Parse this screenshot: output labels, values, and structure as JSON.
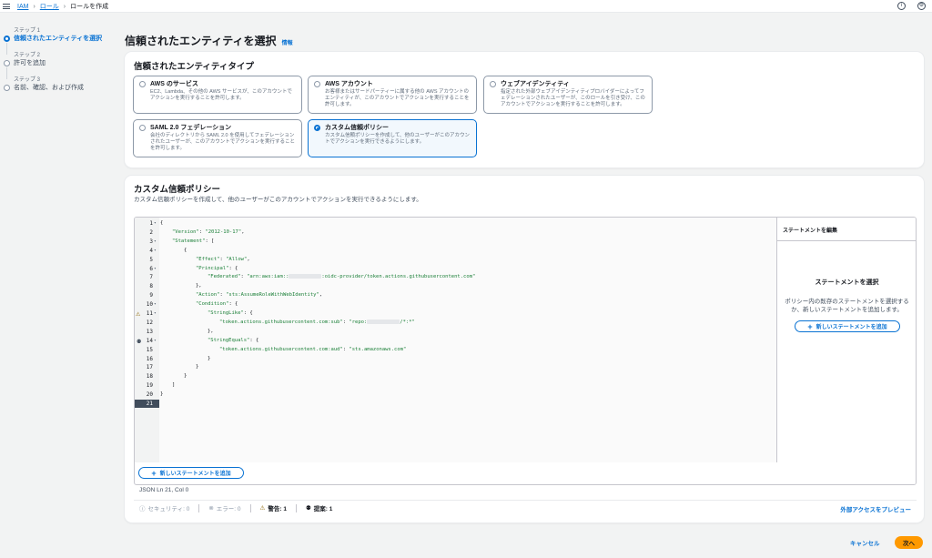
{
  "breadcrumb": {
    "items": [
      "IAM",
      "ロール",
      "ロールを作成"
    ]
  },
  "steps": [
    {
      "num": "ステップ 1",
      "title": "信頼されたエンティティを選択",
      "active": true
    },
    {
      "num": "ステップ 2",
      "title": "許可を追加",
      "active": false
    },
    {
      "num": "ステップ 3",
      "title": "名前、確認、および作成",
      "active": false
    }
  ],
  "page": {
    "title": "信頼されたエンティティを選択",
    "info": "情報"
  },
  "entity_type": {
    "heading": "信頼されたエンティティタイプ",
    "options": [
      {
        "title": "AWS のサービス",
        "desc": "EC2、Lambda、その他の AWS サービスが、このアカウントでアクションを実行することを許可します。",
        "selected": false
      },
      {
        "title": "AWS アカウント",
        "desc": "お客様またはサードパーティーに属する他の AWS アカウントのエンティティが、このアカウントでアクションを実行することを許可します。",
        "selected": false
      },
      {
        "title": "ウェブアイデンティティ",
        "desc": "指定された外部ウェブアイデンティティプロバイダーによってフェデレーションされたユーザーが、このロールを引き受け、このアカウントでアクションを実行することを許可します。",
        "selected": false
      },
      {
        "title": "SAML 2.0 フェデレーション",
        "desc": "会社のディレクトリから SAML 2.0 を使用してフェデレーションされたユーザーが、このアカウントでアクションを実行することを許可します。",
        "selected": false
      },
      {
        "title": "カスタム信頼ポリシー",
        "desc": "カスタム信頼ポリシーを作成して、他のユーザーがこのアカウントでアクションを実行できるようにします。",
        "selected": true
      }
    ]
  },
  "custom_policy": {
    "title": "カスタム信頼ポリシー",
    "desc": "カスタム信頼ポリシーを作成して、他のユーザーがこのアカウントでアクションを実行できるようにします。",
    "code_lines": [
      {
        "n": "1",
        "fold": true,
        "indent": 0,
        "parts": [
          [
            "t",
            "{"
          ]
        ]
      },
      {
        "n": "2",
        "fold": false,
        "indent": 1,
        "parts": [
          [
            "s",
            "\"Version\""
          ],
          [
            "t",
            ": "
          ],
          [
            "s",
            "\"2012-10-17\""
          ],
          [
            "t",
            ","
          ]
        ]
      },
      {
        "n": "3",
        "fold": true,
        "indent": 1,
        "parts": [
          [
            "s",
            "\"Statement\""
          ],
          [
            "t",
            ": ["
          ]
        ]
      },
      {
        "n": "4",
        "fold": true,
        "indent": 2,
        "parts": [
          [
            "t",
            "{"
          ]
        ]
      },
      {
        "n": "5",
        "fold": false,
        "indent": 3,
        "parts": [
          [
            "s",
            "\"Effect\""
          ],
          [
            "t",
            ": "
          ],
          [
            "s",
            "\"Allow\""
          ],
          [
            "t",
            ","
          ]
        ]
      },
      {
        "n": "6",
        "fold": true,
        "indent": 3,
        "parts": [
          [
            "s",
            "\"Principal\""
          ],
          [
            "t",
            ": {"
          ]
        ]
      },
      {
        "n": "7",
        "fold": false,
        "indent": 4,
        "parts": [
          [
            "s",
            "\"Federated\""
          ],
          [
            "t",
            ": "
          ],
          [
            "s",
            "\"arn:aws:iam::"
          ],
          [
            "r",
            ""
          ],
          [
            "s",
            ":oidc-provider/token.actions.githubusercontent.com\""
          ]
        ]
      },
      {
        "n": "8",
        "fold": false,
        "indent": 3,
        "parts": [
          [
            "t",
            "},"
          ]
        ]
      },
      {
        "n": "9",
        "fold": false,
        "indent": 3,
        "parts": [
          [
            "s",
            "\"Action\""
          ],
          [
            "t",
            ": "
          ],
          [
            "s",
            "\"sts:AssumeRoleWithWebIdentity\""
          ],
          [
            "t",
            ","
          ]
        ]
      },
      {
        "n": "10",
        "fold": true,
        "indent": 3,
        "parts": [
          [
            "s",
            "\"Condition\""
          ],
          [
            "t",
            ": {"
          ]
        ]
      },
      {
        "n": "11",
        "fold": true,
        "indent": 4,
        "parts": [
          [
            "s",
            "\"StringLike\""
          ],
          [
            "t",
            ": {"
          ]
        ]
      },
      {
        "n": "12",
        "fold": false,
        "indent": 5,
        "parts": [
          [
            "s",
            "\"token.actions.githubusercontent.com:sub\""
          ],
          [
            "t",
            ": "
          ],
          [
            "s",
            "\"repo:"
          ],
          [
            "r",
            ""
          ],
          [
            "s",
            "/*:*\""
          ]
        ]
      },
      {
        "n": "13",
        "fold": false,
        "indent": 4,
        "parts": [
          [
            "t",
            "},"
          ]
        ]
      },
      {
        "n": "14",
        "fold": true,
        "indent": 4,
        "parts": [
          [
            "s",
            "\"StringEquals\""
          ],
          [
            "t",
            ": {"
          ]
        ]
      },
      {
        "n": "15",
        "fold": false,
        "indent": 5,
        "parts": [
          [
            "s",
            "\"token.actions.githubusercontent.com:aud\""
          ],
          [
            "t",
            ": "
          ],
          [
            "s",
            "\"sts.amazonaws.com\""
          ]
        ]
      },
      {
        "n": "16",
        "fold": false,
        "indent": 4,
        "parts": [
          [
            "t",
            "}"
          ]
        ]
      },
      {
        "n": "17",
        "fold": false,
        "indent": 3,
        "parts": [
          [
            "t",
            "}"
          ]
        ]
      },
      {
        "n": "18",
        "fold": false,
        "indent": 2,
        "parts": [
          [
            "t",
            "}"
          ]
        ]
      },
      {
        "n": "19",
        "fold": false,
        "indent": 1,
        "parts": [
          [
            "t",
            "]"
          ]
        ]
      },
      {
        "n": "20",
        "fold": false,
        "indent": 0,
        "parts": [
          [
            "t",
            "}"
          ]
        ]
      },
      {
        "n": "21",
        "fold": false,
        "indent": 0,
        "parts": []
      }
    ],
    "add_statement": "新しいステートメントを追加",
    "status": "JSON   Ln 21, Col 0"
  },
  "side_panel": {
    "header": "ステートメントを編集",
    "title": "ステートメントを選択",
    "desc": "ポリシー内の既存のステートメントを選択するか、新しいステートメントを追加します。",
    "add_statement": "新しいステートメントを追加"
  },
  "validation": {
    "security": "セキュリティ: 0",
    "errors": "エラー: 0",
    "warnings": "警告: 1",
    "suggestions": "提案: 1",
    "preview": "外部アクセスをプレビュー"
  },
  "footer": {
    "cancel": "キャンセル",
    "next": "次へ"
  },
  "colors": {
    "accent": "#0972d3",
    "primary_button": "#ff9900",
    "warning": "#8d6605"
  }
}
